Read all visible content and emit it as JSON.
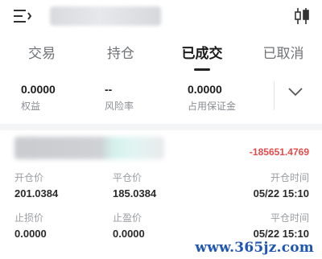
{
  "tabs": [
    {
      "label": "交易"
    },
    {
      "label": "持仓"
    },
    {
      "label": "已成交"
    },
    {
      "label": "已取消"
    }
  ],
  "active_tab": "已成交",
  "summary": [
    {
      "value": "0.0000",
      "label": "权益"
    },
    {
      "value": "--",
      "label": "风险率"
    },
    {
      "value": "0.0000",
      "label": "占用保证金"
    }
  ],
  "record": {
    "pnl": "-185651.4769",
    "open_price_label": "开仓价",
    "open_price": "201.0384",
    "close_price_label": "平仓价",
    "close_price": "185.0384",
    "open_time_label": "开仓时间",
    "open_time": "05/22 15:10",
    "stop_loss_label": "止损价",
    "stop_loss": "0.0000",
    "take_profit_label": "止盈价",
    "take_profit": "0.0000",
    "close_time_label": "平仓时间",
    "close_time": "05/22 15:10"
  },
  "watermark": "www.365jz.com",
  "colors": {
    "loss": "#e44b4b",
    "watermark": "#1f55b5",
    "active_tab": "#1a1a1a"
  },
  "icons": {
    "menu": "menu-icon",
    "chart": "kline-icon",
    "expand": "chevron-down-icon"
  }
}
